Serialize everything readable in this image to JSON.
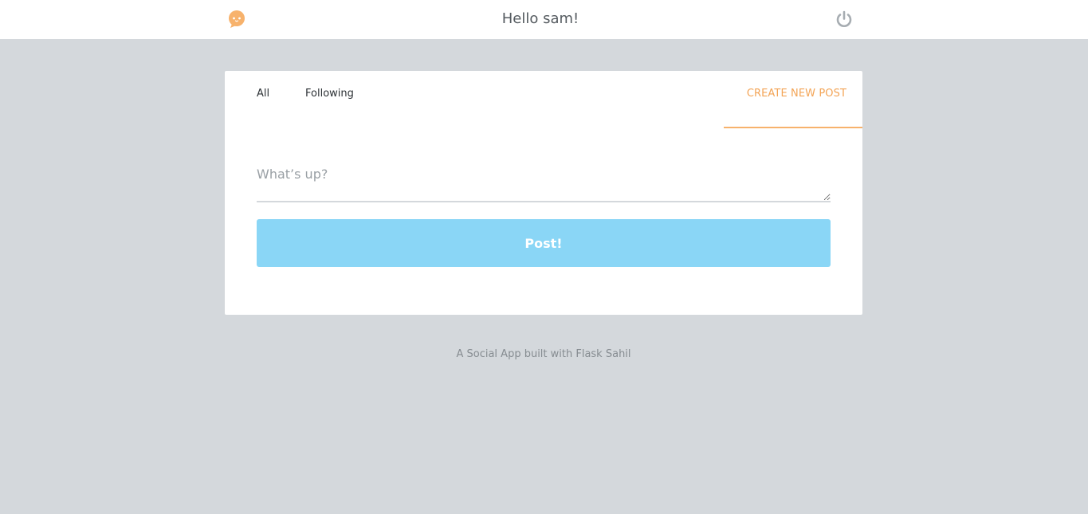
{
  "header": {
    "logo_icon": "chat-bubble-face-icon",
    "greeting": "Hello sam!",
    "logout_icon": "power-icon"
  },
  "tabs": {
    "all_label": "All",
    "following_label": "Following",
    "create_label": "CREATE NEW POST"
  },
  "composer": {
    "placeholder": "What’s up?",
    "value": "",
    "submit_label": "Post!"
  },
  "footer": {
    "text": "A Social App built with Flask Sahil"
  },
  "colors": {
    "background": "#d4d8dc",
    "accent_orange": "#f3a456",
    "button_blue": "#8ad6f6",
    "logout_gray": "#a7adb2"
  }
}
